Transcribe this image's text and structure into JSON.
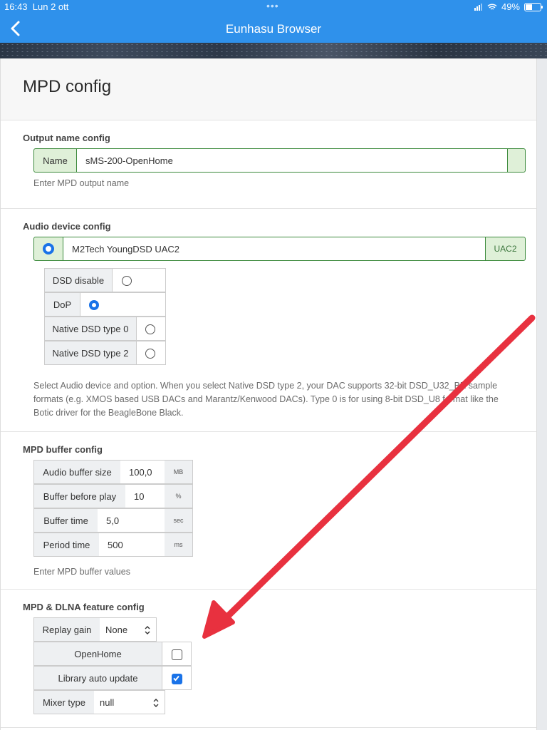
{
  "status": {
    "time": "16:43",
    "date": "Lun 2 ott",
    "battery": "49%",
    "battery_level": 0.49
  },
  "nav": {
    "title": "Eunhasu Browser"
  },
  "page": {
    "title": "MPD config"
  },
  "output": {
    "title": "Output name config",
    "name_label": "Name",
    "name_value": "sMS-200-OpenHome",
    "help": "Enter MPD output name"
  },
  "audio": {
    "title": "Audio device config",
    "device_name": "M2Tech YoungDSD UAC2",
    "device_badge": "UAC2",
    "device_selected": true,
    "options": [
      {
        "label": "DSD disable",
        "selected": false
      },
      {
        "label": "DoP",
        "selected": true
      },
      {
        "label": "Native DSD type 0",
        "selected": false
      },
      {
        "label": "Native DSD type 2",
        "selected": false
      }
    ],
    "help_line1": "Select Audio device and option. When you select Native DSD type 2, your DAC supports 32-bit DSD_U32_BE sample",
    "help_line2": "formats (e.g. XMOS based USB DACs and Marantz/Kenwood DACs). Type 0 is for using 8-bit DSD_U8 format like the",
    "help_line3": "Botic driver for the BeagleBone Black."
  },
  "buffer": {
    "title": "MPD buffer config",
    "rows": [
      {
        "label": "Audio buffer size",
        "value": "100,0",
        "unit": "MB"
      },
      {
        "label": "Buffer before play",
        "value": "10",
        "unit": "%"
      },
      {
        "label": "Buffer time",
        "value": "5,0",
        "unit": "sec"
      },
      {
        "label": "Period time",
        "value": "500",
        "unit": "ms"
      }
    ],
    "help": "Enter MPD buffer values"
  },
  "feature": {
    "title": "MPD & DLNA feature config",
    "replay_gain_label": "Replay gain",
    "replay_gain_value": "None",
    "openhome_label": "OpenHome",
    "openhome_checked": false,
    "library_label": "Library auto update",
    "library_checked": true,
    "mixer_label": "Mixer type",
    "mixer_value": "null"
  },
  "colors": {
    "accent": "#2f91eb",
    "success_bg": "#dff0d8",
    "success_border": "#3c8a3c",
    "annotation_arrow": "#e8313f"
  }
}
